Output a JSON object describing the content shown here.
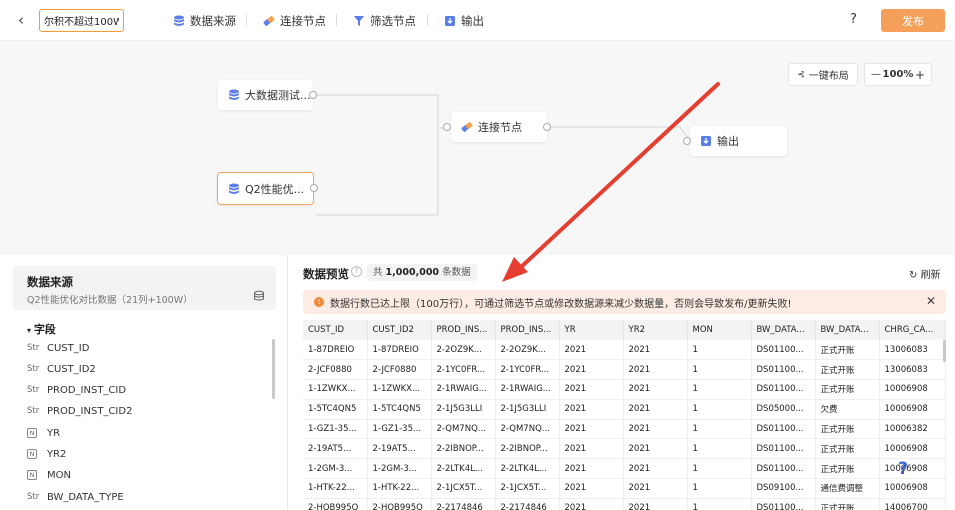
{
  "topbar": {
    "title_value": "尔积不超过100W",
    "tools": [
      {
        "label": "数据来源",
        "icon": "database-icon"
      },
      {
        "label": "连接节点",
        "icon": "link-icon"
      },
      {
        "label": "筛选节点",
        "icon": "filter-icon"
      },
      {
        "label": "输出",
        "icon": "output-icon"
      }
    ],
    "help_label": "?",
    "publish_label": "发布"
  },
  "canvas": {
    "nodes": {
      "source1": "大数据测试...",
      "source2": "Q2性能优...",
      "join": "连接节点",
      "output": "输出"
    },
    "layout_label": "一键布局",
    "zoom_minus": "—",
    "zoom_value": "100%",
    "zoom_plus": "+"
  },
  "left": {
    "source_title": "数据来源",
    "source_sub": "Q2性能优化对比数据（21列+100W）",
    "field_group": "字段",
    "fields": [
      {
        "type": "Str",
        "name": "CUST_ID"
      },
      {
        "type": "Str",
        "name": "CUST_ID2"
      },
      {
        "type": "Str",
        "name": "PROD_INST_CID"
      },
      {
        "type": "Str",
        "name": "PROD_INST_CID2"
      },
      {
        "type": "N",
        "name": "YR"
      },
      {
        "type": "N",
        "name": "YR2"
      },
      {
        "type": "N",
        "name": "MON"
      },
      {
        "type": "Str",
        "name": "BW_DATA_TYPE"
      }
    ]
  },
  "preview": {
    "title": "数据预览",
    "count_prefix": "共",
    "count_value": "1,000,000",
    "count_suffix": "条数据",
    "refresh_label": "刷新",
    "warning": "数据行数已达上限（100万行），可通过筛选节点或修改数据源来减少数据量，否则会导致发布/更新失败!",
    "columns": [
      "CUST_ID",
      "CUST_ID2",
      "PROD_INS...",
      "PROD_INS...",
      "YR",
      "YR2",
      "MON",
      "BW_DATA...",
      "BW_DATA...",
      "CHRG_CA..."
    ],
    "rows": [
      [
        "1-87DREIO",
        "1-87DREIO",
        "2-2OZ9K...",
        "2-2OZ9K...",
        "2021",
        "2021",
        "1",
        "DS01100...",
        "正式开账",
        "13006083"
      ],
      [
        "2-JCF0880",
        "2-JCF0880",
        "2-1YC0FR...",
        "2-1YC0FR...",
        "2021",
        "2021",
        "1",
        "DS01100...",
        "正式开账",
        "13006083"
      ],
      [
        "1-1ZWKX...",
        "1-1ZWKX...",
        "2-1RWAIG...",
        "2-1RWAIG...",
        "2021",
        "2021",
        "1",
        "DS01100...",
        "正式开账",
        "10006908"
      ],
      [
        "1-5TC4QN5",
        "1-5TC4QN5",
        "2-1J5G3LLI",
        "2-1J5G3LLI",
        "2021",
        "2021",
        "1",
        "DS05000...",
        "欠费",
        "10006908"
      ],
      [
        "1-GZ1-35...",
        "1-GZ1-35...",
        "2-QM7NQ...",
        "2-QM7NQ...",
        "2021",
        "2021",
        "1",
        "DS01100...",
        "正式开账",
        "10006382"
      ],
      [
        "2-19AT5...",
        "2-19AT5...",
        "2-2IBNOP...",
        "2-2IBNOP...",
        "2021",
        "2021",
        "1",
        "DS01100...",
        "正式开账",
        "10006908"
      ],
      [
        "1-2GM-3...",
        "1-2GM-3...",
        "2-2LTK4L...",
        "2-2LTK4L...",
        "2021",
        "2021",
        "1",
        "DS01100...",
        "正式开账",
        "10006908"
      ],
      [
        "1-HTK-22...",
        "1-HTK-22...",
        "2-1JCX5T...",
        "2-1JCX5T...",
        "2021",
        "2021",
        "1",
        "DS09100...",
        "通信费调整",
        "10006908"
      ],
      [
        "2-HQB995Q",
        "2-HQB995Q",
        "2-2174846",
        "2-2174846",
        "2021",
        "2021",
        "1",
        "DS01100...",
        "正式开账",
        "14006700"
      ]
    ],
    "help_fab": "?"
  },
  "colors": {
    "accent": "#f5a05a",
    "warning_bg": "#fdece3",
    "arrow": "#e53d2f",
    "icon_blue": "#5b7ee8"
  }
}
